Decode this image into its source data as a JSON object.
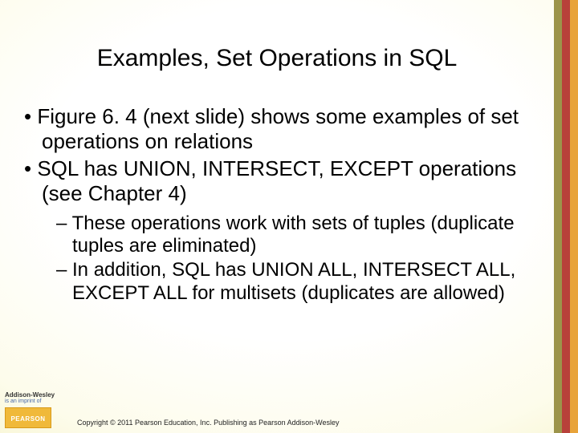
{
  "title": "Examples, Set Operations in SQL",
  "bullets": [
    "Figure 6. 4 (next slide) shows some examples of set operations on relations",
    "SQL has UNION, INTERSECT, EXCEPT operations (see Chapter 4)"
  ],
  "sub_bullets": [
    "These operations work with sets of tuples (duplicate tuples are eliminated)",
    "In addition, SQL has UNION ALL, INTERSECT ALL, EXCEPT ALL for multisets (duplicates are allowed)"
  ],
  "footer": {
    "imprint": "Addison-Wesley",
    "imprint_sub": "is an imprint of",
    "brand": "PEARSON",
    "copyright": "Copyright © 2011 Pearson Education, Inc. Publishing as Pearson Addison-Wesley"
  }
}
